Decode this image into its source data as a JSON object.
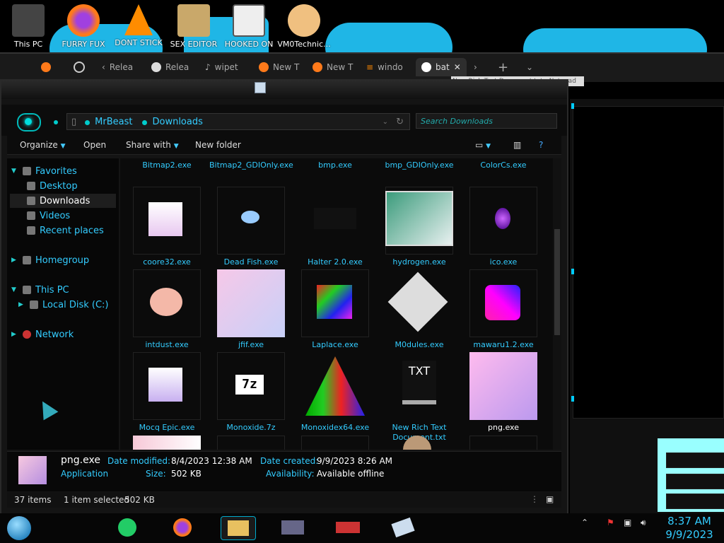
{
  "desktop": {
    "icons": [
      {
        "label": "This PC",
        "icon": "computer-icon",
        "color": "#444444"
      },
      {
        "label": "FURRY FUX",
        "icon": "firefox-icon",
        "color": "#ff7a1a"
      },
      {
        "label": "DONT STICK",
        "icon": "vlc-cone-icon",
        "color": "#ff8c00"
      },
      {
        "label": "SEX EDITOR",
        "icon": "hex-editor-icon",
        "color": "#c9a86a"
      },
      {
        "label": "HOOKED ON",
        "icon": "maze-icon",
        "color": "#eeeeee"
      },
      {
        "label": "VM0Technic...",
        "icon": "doctor-icon",
        "color": "#f0c080"
      }
    ]
  },
  "browser": {
    "tabs": [
      {
        "label": "Relea",
        "icon": "back-icon"
      },
      {
        "label": "Relea",
        "icon": "github-icon"
      },
      {
        "label": "wipet",
        "icon": "script-icon"
      },
      {
        "label": "New T",
        "icon": "firefox-icon"
      },
      {
        "label": "New T",
        "icon": "firefox-icon"
      },
      {
        "label": "windo",
        "icon": "stackoverflow-icon"
      },
      {
        "label": "bat",
        "icon": "google-icon"
      }
    ],
    "tooltip": "New Rich Text Document.txt - Notepad"
  },
  "explorer": {
    "breadcrumb": [
      "MrBeast",
      "Downloads"
    ],
    "search_placeholder": "Search Downloads",
    "toolbar": {
      "organize": "Organize",
      "open": "Open",
      "share": "Share with",
      "newfolder": "New folder"
    },
    "sidebar": {
      "favorites": "Favorites",
      "desktop": "Desktop",
      "downloads": "Downloads",
      "videos": "Videos",
      "recent": "Recent places",
      "homegroup": "Homegroup",
      "thispc": "This PC",
      "localdisk": "Local Disk (C:)",
      "network": "Network"
    },
    "top_row_names": [
      "Bitmap2.exe",
      "Bitmap2_GDIOnly.exe",
      "bmp.exe",
      "bmp_GDIOnly.exe",
      "ColorCs.exe"
    ],
    "files": [
      {
        "name": "coore32.exe",
        "icon": "anime-girl-icon"
      },
      {
        "name": "Dead Fish.exe",
        "icon": "fish-icon"
      },
      {
        "name": "Halter 2.0.exe",
        "icon": "blank-exe-icon"
      },
      {
        "name": "hydrogen.exe",
        "icon": "window-screenshot-icon"
      },
      {
        "name": "ico.exe",
        "icon": "globe-icon"
      },
      {
        "name": "intdust.exe",
        "icon": "palette-icon"
      },
      {
        "name": "jfif.exe",
        "icon": "anime-girl-icon"
      },
      {
        "name": "Laplace.exe",
        "icon": "rainbow-noise-icon"
      },
      {
        "name": "M0dules.exe",
        "icon": "gray-tiles-icon"
      },
      {
        "name": "mawaru1.2.exe",
        "icon": "glitch-square-icon"
      },
      {
        "name": "Mocq Epic.exe",
        "icon": "anime-girl-icon"
      },
      {
        "name": "Monoxide.7z",
        "icon": "7zip-icon"
      },
      {
        "name": "Monoxidex64.exe",
        "icon": "chemistry-flasks-icon"
      },
      {
        "name": "New Rich Text Document.txt",
        "icon": "txt-file-icon"
      },
      {
        "name": "png.exe",
        "icon": "anime-girl-icon"
      }
    ],
    "details": {
      "name": "png.exe",
      "type": "Application",
      "date_modified_label": "Date modified:",
      "date_modified": "8/4/2023 12:38 AM",
      "size_label": "Size:",
      "size": "502 KB",
      "date_created_label": "Date created:",
      "date_created": "9/9/2023 8:26 AM",
      "availability_label": "Availability:",
      "availability": "Available offline"
    },
    "status": {
      "items": "37 items",
      "selected": "1 item selected",
      "size": "502 KB"
    }
  },
  "taskbar": {
    "time": "8:37 AM",
    "date": "9/9/2023",
    "buttons": [
      "sheets-icon",
      "firefox-icon",
      "explorer-icon",
      "card-icon",
      "gamepad-icon",
      "notepad-icon"
    ]
  }
}
